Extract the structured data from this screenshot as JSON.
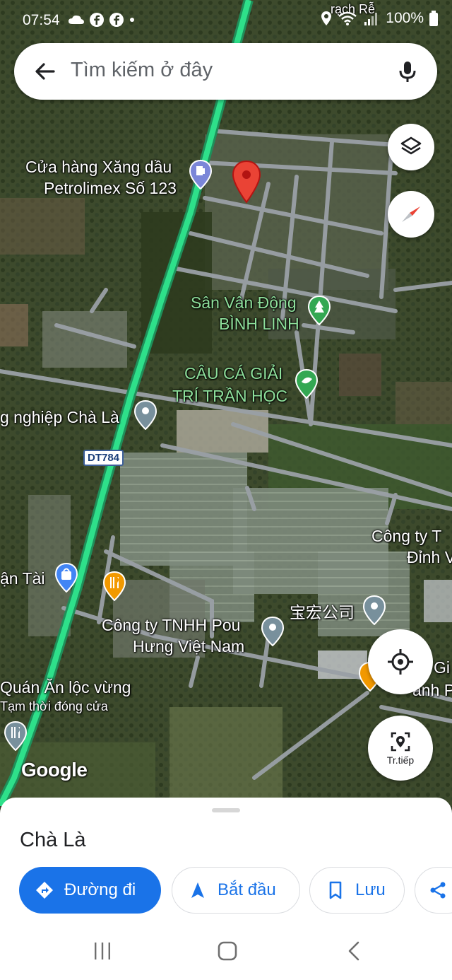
{
  "status_bar": {
    "time": "07:54",
    "battery": "100%",
    "icons_left": [
      "cloud-icon",
      "facebook-icon",
      "facebook-icon",
      "dot-icon"
    ],
    "icons_right": [
      "location-icon",
      "wifi-icon",
      "signal-icon",
      "battery-icon"
    ]
  },
  "search": {
    "placeholder": "Tìm kiếm ở đây"
  },
  "map": {
    "corner_label": "rạch Rễ",
    "labels": {
      "gas_station_line1": "Cửa hàng Xăng dầu",
      "gas_station_line2": "Petrolimex Số 123",
      "stadium_line1": "Sân Vận Động",
      "stadium_line2": "BÌNH LINH",
      "fishing_line1": "CÂU CÁ GIẢI",
      "fishing_line2": "TRÍ TRẦN HỌC",
      "industrial_zone": "g nghiệp Chà Là",
      "route": "DT784",
      "company_right_line1": "Công ty T",
      "company_right_line2": "Đỉnh V",
      "shop_left": "ận Tài",
      "baohong": "宝宏公司",
      "pouhung_line1": "Công ty TNHH Pou",
      "pouhung_line2": "Hưng Việt Nam",
      "right_partial_1": "Gi",
      "right_partial_2": "ành P",
      "restaurant": "Quán Ăn lộc vừng",
      "restaurant_status": "Tạm thời đóng cửa",
      "google_logo": "Google"
    }
  },
  "controls": {
    "explore_label": "Tr.tiếp"
  },
  "sheet": {
    "place_name": "Chà Là",
    "directions_label": "Đường đi",
    "start_label": "Bắt đầu",
    "save_label": "Lưu"
  },
  "colors": {
    "accent": "#1a73e8",
    "pin_red": "#ea4335",
    "road_green": "#2ee08a",
    "poi_gray": "#78909c",
    "poi_orange": "#f29900",
    "poi_blue": "#4285f4",
    "poi_green": "#34a853"
  }
}
